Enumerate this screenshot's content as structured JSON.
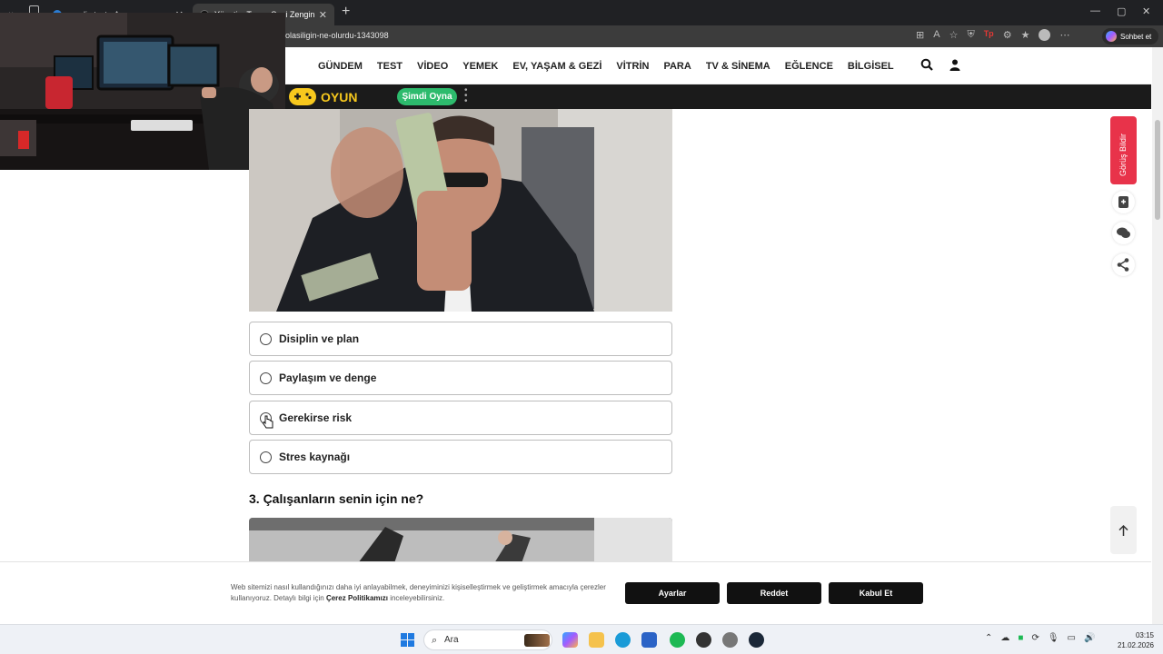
{
  "browser": {
    "tabs": [
      {
        "title": "onedio test - Arama",
        "active": false
      },
      {
        "title": "Yönetim Tarzın Seni Zengin mi Ede",
        "active": true
      }
    ],
    "url": "olasiligin-ne-olurdu-1343098",
    "copilot_label": "Sohbet et",
    "tp_badge": "Tp"
  },
  "site": {
    "nav": [
      "GÜNDEM",
      "TEST",
      "VİDEO",
      "YEMEK",
      "EV, YAŞAM & GEZİ",
      "VİTRİN",
      "PARA",
      "TV & SİNEMA",
      "EĞLENCE",
      "BİLGİSEL"
    ],
    "oyun": {
      "label": "OYUN",
      "button": "Şimdi Oyna"
    }
  },
  "quiz": {
    "options": [
      "Disiplin ve plan",
      "Paylaşım ve denge",
      "Gerekirse risk",
      "Stres kaynağı"
    ],
    "next_question": "3. Çalışanların senin için ne?"
  },
  "rail": {
    "feedback_label": "Görüş Bildir"
  },
  "cookie": {
    "text_before": "Web sitemizi nasıl kullandığınızı daha iyi anlayabilmek, deneyiminizi kişiselleştirmek ve geliştirmek amacıyla çerezler kullanıyoruz. Detaylı bilgi için ",
    "link": "Çerez Politikamızı",
    "text_after": " inceleyebilirsiniz.",
    "buttons": {
      "settings": "Ayarlar",
      "reject": "Reddet",
      "accept": "Kabul Et"
    }
  },
  "taskbar": {
    "search_placeholder": "Ara",
    "time": "03:15",
    "date": "21.02.2026"
  },
  "colors": {
    "feedback": "#e8334a",
    "oyun_yellow": "#f7c81d",
    "oyun_green": "#2dbb6d"
  }
}
